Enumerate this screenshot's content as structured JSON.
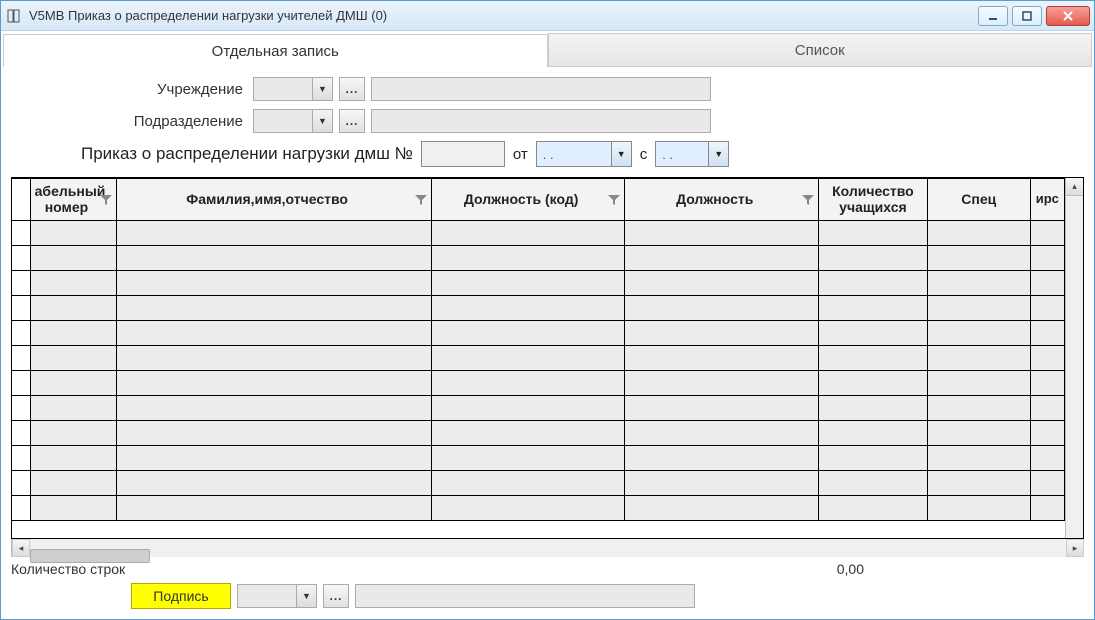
{
  "window": {
    "title": "V5MB Приказ о распределении нагрузки учителей ДМШ (0)"
  },
  "tabs": {
    "single": "Отдельная запись",
    "list": "Список"
  },
  "form": {
    "institution_label": "Учреждение",
    "department_label": "Подразделение",
    "order_label": "Приказ о распределении нагрузки дмш №",
    "from_label": "от",
    "with_label": "с",
    "date_from": ". .",
    "date_with": ". .",
    "browse_btn": "..."
  },
  "grid": {
    "columns": {
      "tab_no": "абельный номер",
      "fio": "Фамилия,имя,отчество",
      "position_code": "Должность (код)",
      "position": "Должность",
      "students_count": "Количество учащихся",
      "spec": "Спец",
      "extra": "ирс"
    },
    "rows": 12
  },
  "footer": {
    "rows_label": "Количество строк",
    "rows_value": "0,00",
    "sign_label": "Подпись"
  }
}
